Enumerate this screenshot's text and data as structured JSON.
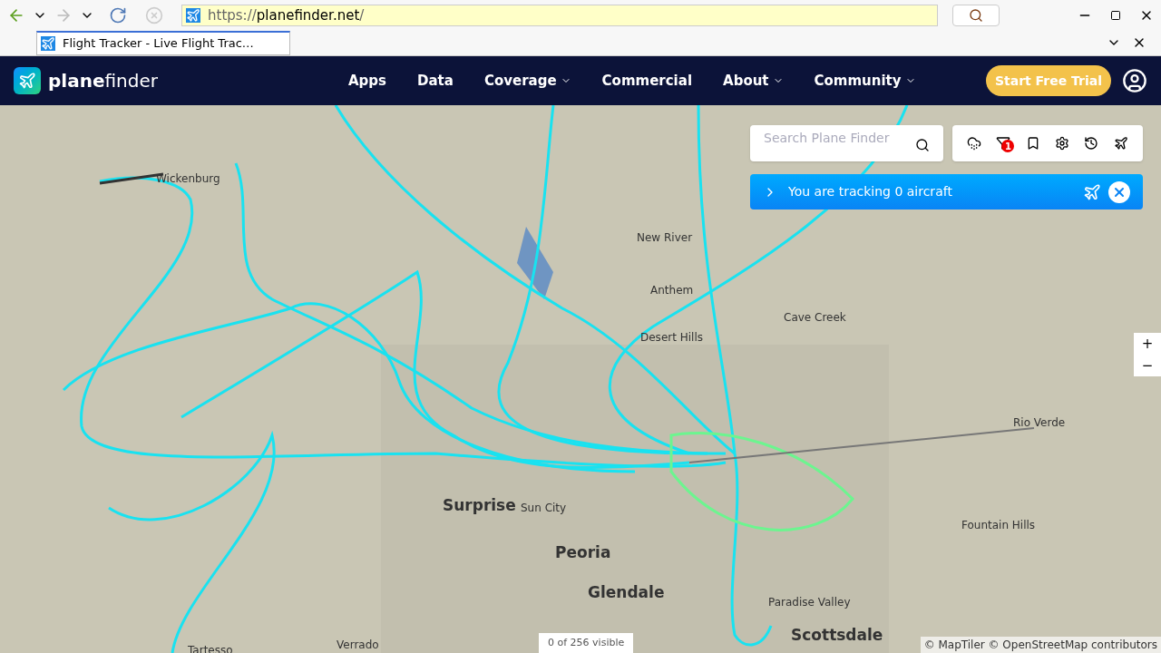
{
  "browser": {
    "url_scheme": "https://",
    "url_host": "planefinder.net",
    "url_path": "/",
    "tab_title": "Flight Tracker - Live Flight Trac…"
  },
  "nav": {
    "logo_bold": "plane",
    "logo_light": "finder",
    "items": [
      {
        "label": "Apps",
        "dropdown": false
      },
      {
        "label": "Data",
        "dropdown": false
      },
      {
        "label": "Coverage",
        "dropdown": true
      },
      {
        "label": "Commercial",
        "dropdown": false
      },
      {
        "label": "About",
        "dropdown": true
      },
      {
        "label": "Community",
        "dropdown": true
      }
    ],
    "trial_button": "Start Free Trial"
  },
  "search": {
    "placeholder": "Search Plane Finder"
  },
  "toolbar": {
    "filter_badge": "1"
  },
  "tracking": {
    "text": "You are tracking 0 aircraft"
  },
  "zoom": {
    "in": "+",
    "out": "−"
  },
  "map_labels": [
    {
      "text": "Wickenburg",
      "kind": "town"
    },
    {
      "text": "New River",
      "kind": "town"
    },
    {
      "text": "Anthem",
      "kind": "town"
    },
    {
      "text": "Cave Creek",
      "kind": "town"
    },
    {
      "text": "Desert Hills",
      "kind": "town"
    },
    {
      "text": "Rio Verde",
      "kind": "town"
    },
    {
      "text": "Surprise",
      "kind": "city"
    },
    {
      "text": "Sun City",
      "kind": "town"
    },
    {
      "text": "Fountain Hills",
      "kind": "town"
    },
    {
      "text": "Peoria",
      "kind": "city"
    },
    {
      "text": "Glendale",
      "kind": "city"
    },
    {
      "text": "Paradise Valley",
      "kind": "town"
    },
    {
      "text": "Scottsdale",
      "kind": "city"
    },
    {
      "text": "Verrado",
      "kind": "town"
    },
    {
      "text": "Tartesso",
      "kind": "town"
    }
  ],
  "visible_count": "0 of 256 visible",
  "attribution": "© MapTiler © OpenStreetMap contributors"
}
